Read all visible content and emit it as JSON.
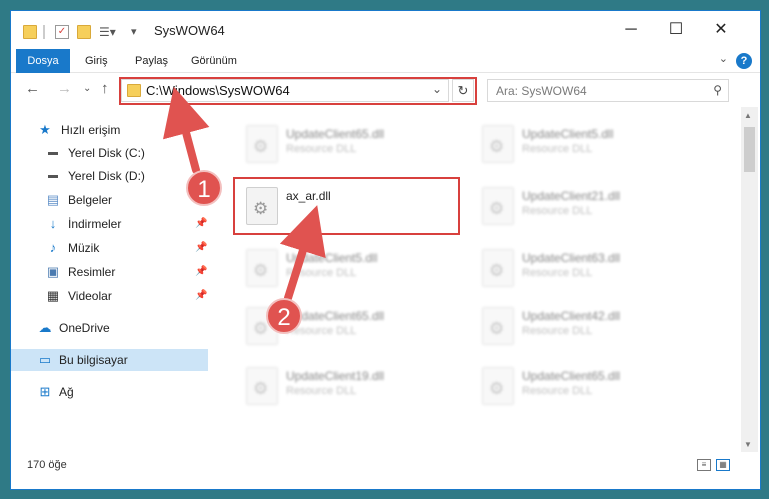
{
  "window": {
    "title": "SysWOW64"
  },
  "ribbon": {
    "tabs": [
      "Dosya",
      "Giriş",
      "Paylaş",
      "Görünüm"
    ]
  },
  "address": {
    "path": "C:\\Windows\\SysWOW64"
  },
  "search": {
    "placeholder": "Ara: SysWOW64"
  },
  "sidebar": {
    "items": [
      {
        "label": "Hızlı erişim"
      },
      {
        "label": "Yerel Disk (C:)"
      },
      {
        "label": "Yerel Disk (D:)"
      },
      {
        "label": "Belgeler"
      },
      {
        "label": "İndirmeler"
      },
      {
        "label": "Müzik"
      },
      {
        "label": "Resimler"
      },
      {
        "label": "Videolar"
      },
      {
        "label": "OneDrive"
      },
      {
        "label": "Bu bilgisayar"
      },
      {
        "label": "Ağ"
      }
    ]
  },
  "files": [
    {
      "name": "UpdateClient65.dll",
      "type": "Resource DLL"
    },
    {
      "name": "UpdateClient5.dll",
      "type": "Resource DLL"
    },
    {
      "name": "ax_ar.dll",
      "type": ""
    },
    {
      "name": "UpdateClient21.dll",
      "type": "Resource DLL"
    },
    {
      "name": "UpdateClient5.dll",
      "type": "Resource DLL"
    },
    {
      "name": "UpdateClient63.dll",
      "type": "Resource DLL"
    },
    {
      "name": "UpdateClient65.dll",
      "type": "Resource DLL"
    },
    {
      "name": "UpdateClient42.dll",
      "type": "Resource DLL"
    },
    {
      "name": "UpdateClient19.dll",
      "type": "Resource DLL"
    },
    {
      "name": "UpdateClient65.dll",
      "type": "Resource DLL"
    }
  ],
  "status": {
    "count": "170 öğe"
  },
  "annotations": {
    "step1": "1",
    "step2": "2"
  },
  "colors": {
    "accent": "#1979ca",
    "highlight": "#d8403d",
    "selected": "#cce4f7"
  }
}
